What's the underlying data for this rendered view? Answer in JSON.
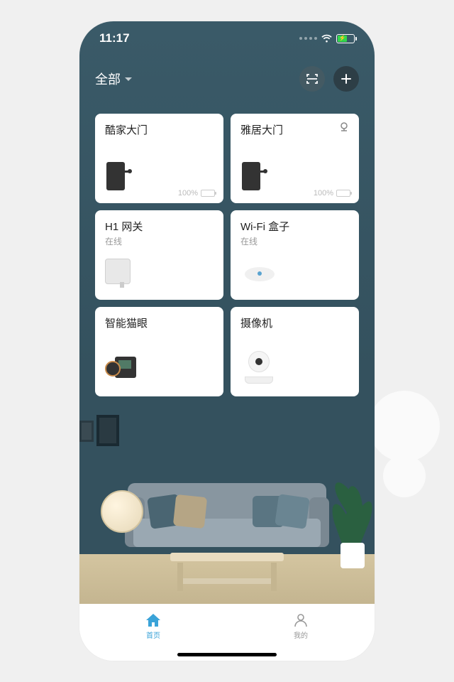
{
  "status": {
    "time": "11:17"
  },
  "header": {
    "filter_label": "全部"
  },
  "devices": [
    {
      "name": "酷家大门",
      "status": "",
      "battery": "100%",
      "type": "lock",
      "has_corner_icon": false
    },
    {
      "name": "雅居大门",
      "status": "",
      "battery": "100%",
      "type": "lock",
      "has_corner_icon": true
    },
    {
      "name": "H1 网关",
      "status": "在线",
      "battery": "",
      "type": "gateway",
      "has_corner_icon": false
    },
    {
      "name": "Wi-Fi 盒子",
      "status": "在线",
      "battery": "",
      "type": "wifi",
      "has_corner_icon": false
    },
    {
      "name": "智能猫眼",
      "status": "",
      "battery": "",
      "type": "peephole",
      "has_corner_icon": false
    },
    {
      "name": "摄像机",
      "status": "",
      "battery": "",
      "type": "camera",
      "has_corner_icon": false
    }
  ],
  "nav": {
    "home": "首页",
    "mine": "我的"
  }
}
